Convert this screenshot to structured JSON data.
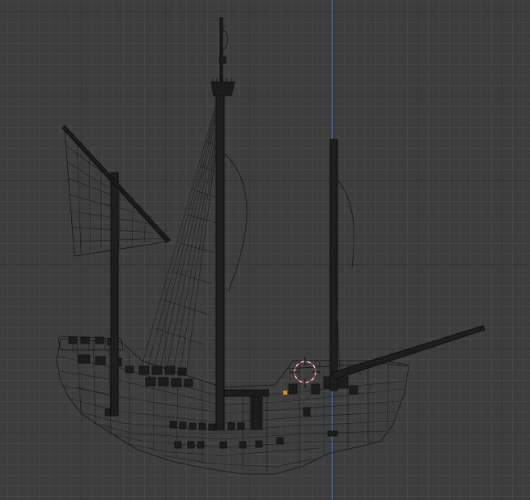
{
  "viewport": {
    "view_type": "3D viewport - wireframe",
    "background_color": "#3d3d3d",
    "grid_color_major": "#333333",
    "grid_color_minor": "#474747",
    "z_axis_color": "#4f7fbf",
    "cursor_colors": [
      "#ffffff",
      "#e23b3b"
    ],
    "active_selection_color": "#e08a1e"
  },
  "scene": {
    "object": "ship-model",
    "icons": {
      "cursor": "3d-cursor-icon"
    }
  }
}
